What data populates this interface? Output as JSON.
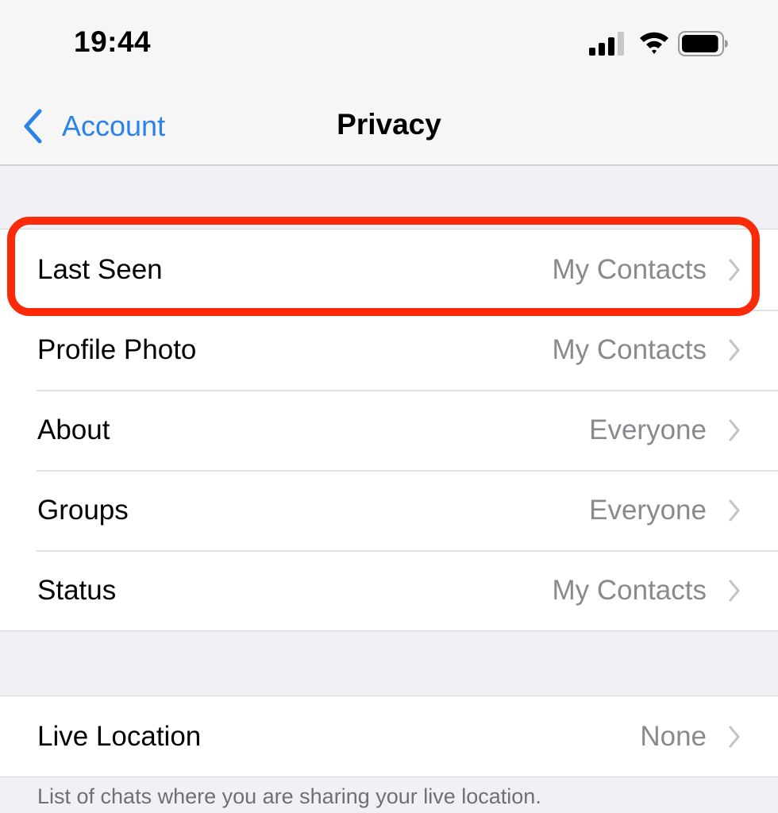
{
  "status_bar": {
    "time": "19:44",
    "signal_icon": "cellular-signal-icon",
    "signal_bars_active": 3,
    "signal_bars_total": 4,
    "wifi_icon": "wifi-icon",
    "battery_icon": "battery-icon",
    "battery_level_percent": 95
  },
  "nav": {
    "back_icon": "chevron-left-icon",
    "back_label": "Account",
    "title": "Privacy"
  },
  "colors": {
    "accent_blue": "#2b83ea",
    "highlight_red": "#fb2a0b",
    "value_gray": "#8a8a8e",
    "background": "#f0f0f5"
  },
  "sections": [
    {
      "rows": [
        {
          "label": "Last Seen",
          "value": "My Contacts",
          "highlighted": true
        },
        {
          "label": "Profile Photo",
          "value": "My Contacts"
        },
        {
          "label": "About",
          "value": "Everyone"
        },
        {
          "label": "Groups",
          "value": "Everyone"
        },
        {
          "label": "Status",
          "value": "My Contacts"
        }
      ]
    },
    {
      "rows": [
        {
          "label": "Live Location",
          "value": "None"
        }
      ],
      "footer": "List of chats where you are sharing your live location."
    }
  ]
}
